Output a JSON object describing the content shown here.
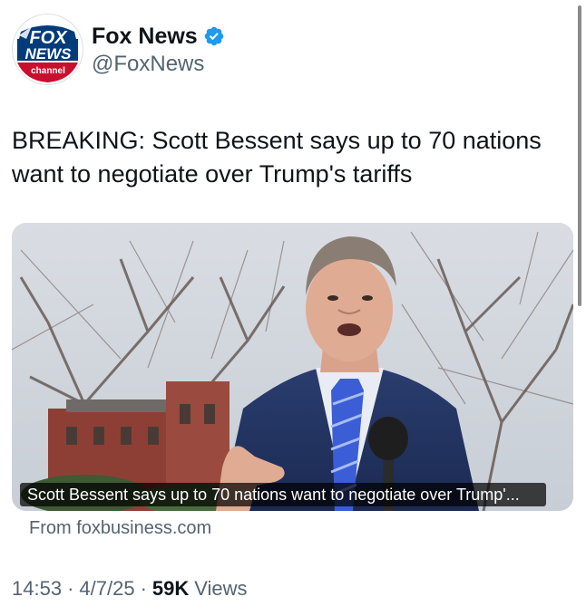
{
  "account": {
    "name": "Fox News",
    "handle": "@FoxNews",
    "avatar_logo_text": [
      "FOX",
      "NEWS",
      "channel"
    ],
    "verified_color": "#1d9bf0"
  },
  "tweet": {
    "text": "BREAKING: Scott Bessent says up to 70 nations want to negotiate over Trump's tariffs"
  },
  "link_card": {
    "caption": "Scott Bessent says up to 70 nations want to negotiate over Trump'...",
    "source": "From foxbusiness.com"
  },
  "meta": {
    "time": "14:53",
    "separator": "·",
    "date": "4/7/25",
    "views_count": "59K",
    "views_label": "Views"
  },
  "colors": {
    "text_primary": "#0f1419",
    "text_secondary": "#536471",
    "fox_blue": "#003b7a",
    "fox_red": "#c8102e"
  }
}
